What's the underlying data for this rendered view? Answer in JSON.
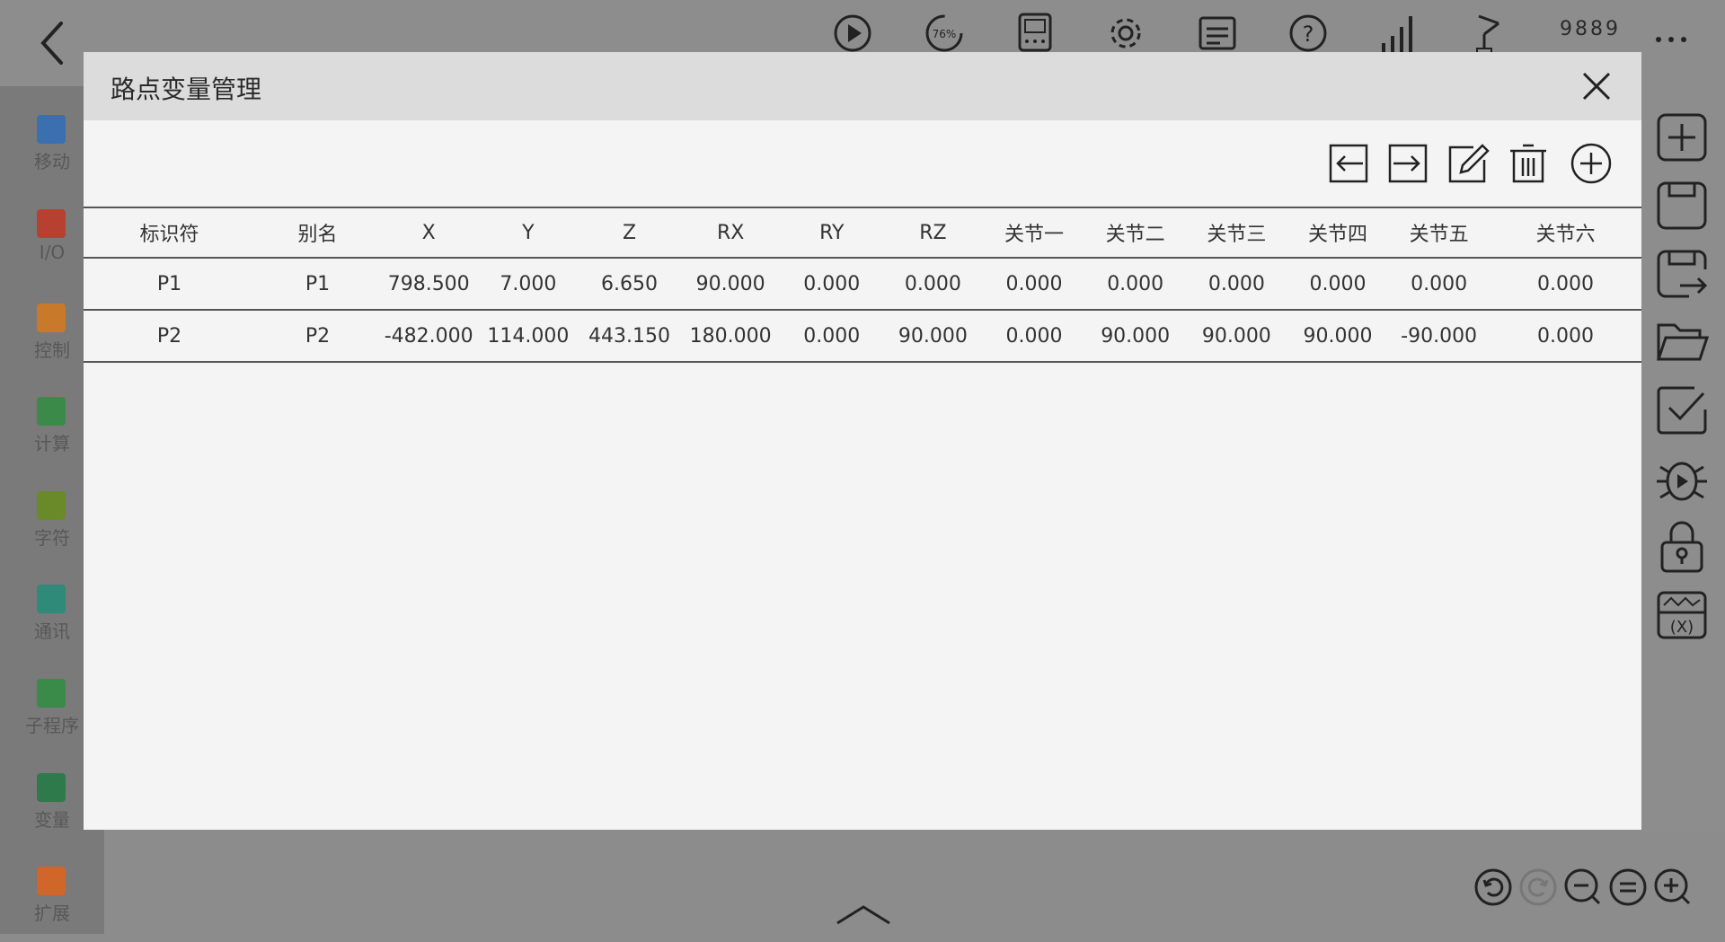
{
  "top_bar": {
    "value_display": "9889",
    "icons": [
      "play-icon",
      "speed-icon",
      "teach-pendant-icon",
      "settings-icon",
      "log-icon",
      "help-icon",
      "signal-icon",
      "robot-arm-icon"
    ]
  },
  "sidebar": {
    "items": [
      {
        "label": "移动",
        "color": "#3a6fb0"
      },
      {
        "label": "I/O",
        "color": "#b84030"
      },
      {
        "label": "控制",
        "color": "#c8792a"
      },
      {
        "label": "计算",
        "color": "#3b8a4a"
      },
      {
        "label": "字符",
        "color": "#6a8a2a"
      },
      {
        "label": "通讯",
        "color": "#2f8a7a"
      },
      {
        "label": "子程序",
        "color": "#3a8a4a"
      },
      {
        "label": "变量",
        "color": "#2f7a4a"
      },
      {
        "label": "扩展",
        "color": "#d0662a"
      }
    ]
  },
  "dialog": {
    "title": "路点变量管理",
    "columns": [
      "标识符",
      "别名",
      "X",
      "Y",
      "Z",
      "RX",
      "RY",
      "RZ",
      "关节一",
      "关节二",
      "关节三",
      "关节四",
      "关节五",
      "关节六"
    ],
    "rows": [
      [
        "P1",
        "P1",
        "798.500",
        "7.000",
        "6.650",
        "90.000",
        "0.000",
        "0.000",
        "0.000",
        "0.000",
        "0.000",
        "0.000",
        "0.000",
        "0.000"
      ],
      [
        "P2",
        "P2",
        "-482.000",
        "114.000",
        "443.150",
        "180.000",
        "0.000",
        "90.000",
        "0.000",
        "90.000",
        "90.000",
        "90.000",
        "-90.000",
        "0.000"
      ]
    ]
  },
  "colors": {
    "header_bg": "#dcdcdc",
    "dialog_bg": "#f4f4f4",
    "overlay": "#8c8c8c"
  }
}
